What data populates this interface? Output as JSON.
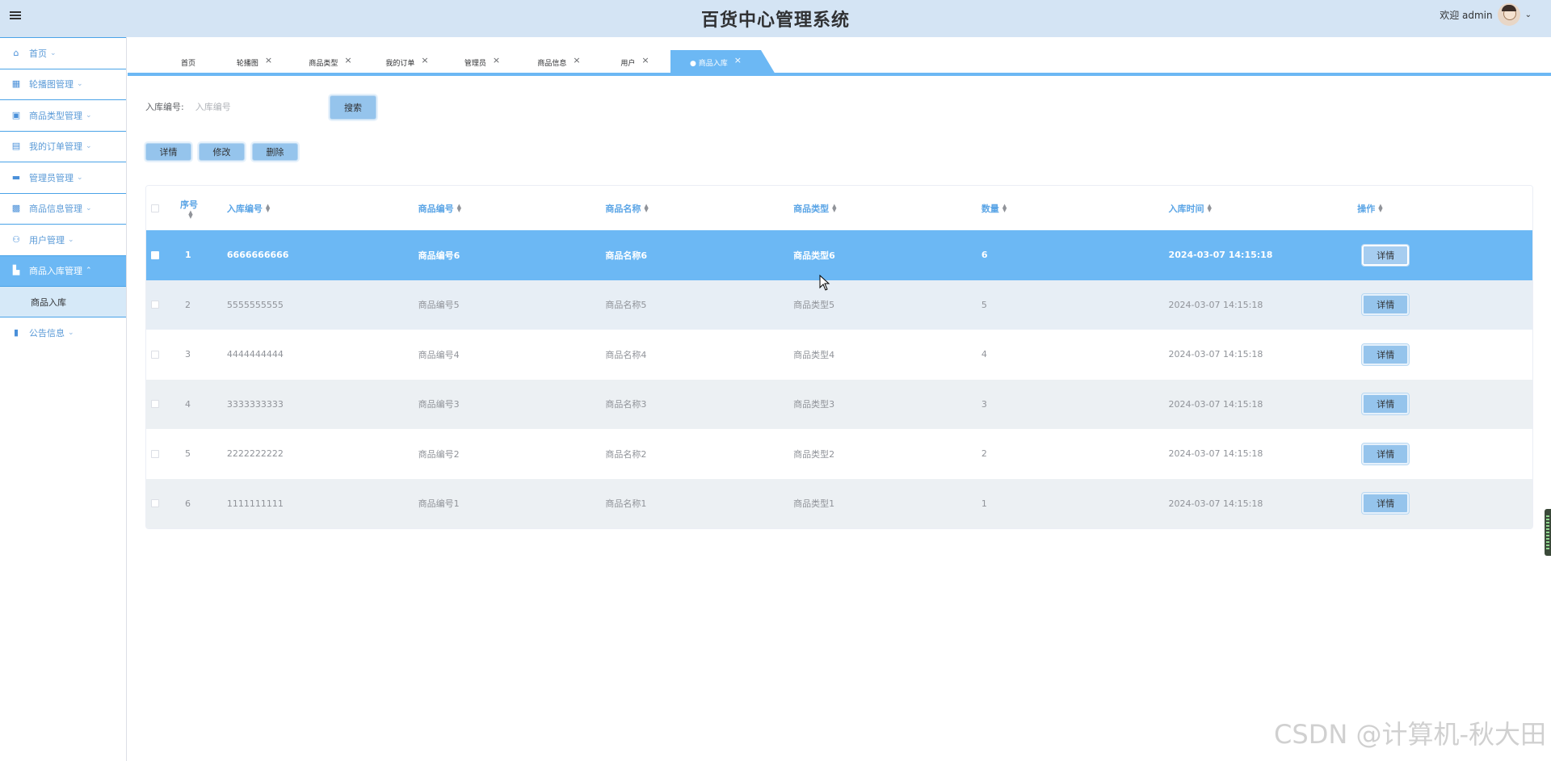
{
  "header": {
    "title": "百货中心管理系统",
    "welcome": "欢迎 admin"
  },
  "sidebar": {
    "items": [
      {
        "label": "首页"
      },
      {
        "label": "轮播图管理"
      },
      {
        "label": "商品类型管理"
      },
      {
        "label": "我的订单管理"
      },
      {
        "label": "管理员管理"
      },
      {
        "label": "商品信息管理"
      },
      {
        "label": "用户管理"
      },
      {
        "label": "商品入库管理"
      },
      {
        "label": "公告信息"
      }
    ],
    "sub_item": "商品入库"
  },
  "tabs": [
    {
      "label": "首页"
    },
    {
      "label": "轮播图"
    },
    {
      "label": "商品类型"
    },
    {
      "label": "我的订单"
    },
    {
      "label": "管理员"
    },
    {
      "label": "商品信息"
    },
    {
      "label": "用户"
    },
    {
      "label": "● 商品入库"
    }
  ],
  "tab_close": "×",
  "search": {
    "label": "入库编号:",
    "placeholder": "入库编号",
    "button": "搜索"
  },
  "actions": {
    "detail": "详情",
    "edit": "修改",
    "delete": "删除"
  },
  "table": {
    "headers": {
      "index": "序号",
      "code": "入库编号",
      "goods_code": "商品编号",
      "goods_name": "商品名称",
      "goods_type": "商品类型",
      "qty": "数量",
      "time": "入库时间",
      "op": "操作"
    },
    "rows": [
      {
        "index": "1",
        "code": "6666666666",
        "goods_code": "商品编号6",
        "goods_name": "商品名称6",
        "goods_type": "商品类型6",
        "qty": "6",
        "time": "2024-03-07 14:15:18",
        "btn": "详情"
      },
      {
        "index": "2",
        "code": "5555555555",
        "goods_code": "商品编号5",
        "goods_name": "商品名称5",
        "goods_type": "商品类型5",
        "qty": "5",
        "time": "2024-03-07 14:15:18",
        "btn": "详情"
      },
      {
        "index": "3",
        "code": "4444444444",
        "goods_code": "商品编号4",
        "goods_name": "商品名称4",
        "goods_type": "商品类型4",
        "qty": "4",
        "time": "2024-03-07 14:15:18",
        "btn": "详情"
      },
      {
        "index": "4",
        "code": "3333333333",
        "goods_code": "商品编号3",
        "goods_name": "商品名称3",
        "goods_type": "商品类型3",
        "qty": "3",
        "time": "2024-03-07 14:15:18",
        "btn": "详情"
      },
      {
        "index": "5",
        "code": "2222222222",
        "goods_code": "商品编号2",
        "goods_name": "商品名称2",
        "goods_type": "商品类型2",
        "qty": "2",
        "time": "2024-03-07 14:15:18",
        "btn": "详情"
      },
      {
        "index": "6",
        "code": "1111111111",
        "goods_code": "商品编号1",
        "goods_name": "商品名称1",
        "goods_type": "商品类型1",
        "qty": "1",
        "time": "2024-03-07 14:15:18",
        "btn": "详情"
      }
    ]
  },
  "watermark": "CSDN @计算机-秋大田",
  "colors": {
    "header_bg": "#d4e4f4",
    "accent": "#6cb8f4",
    "button": "#95c4ec"
  }
}
